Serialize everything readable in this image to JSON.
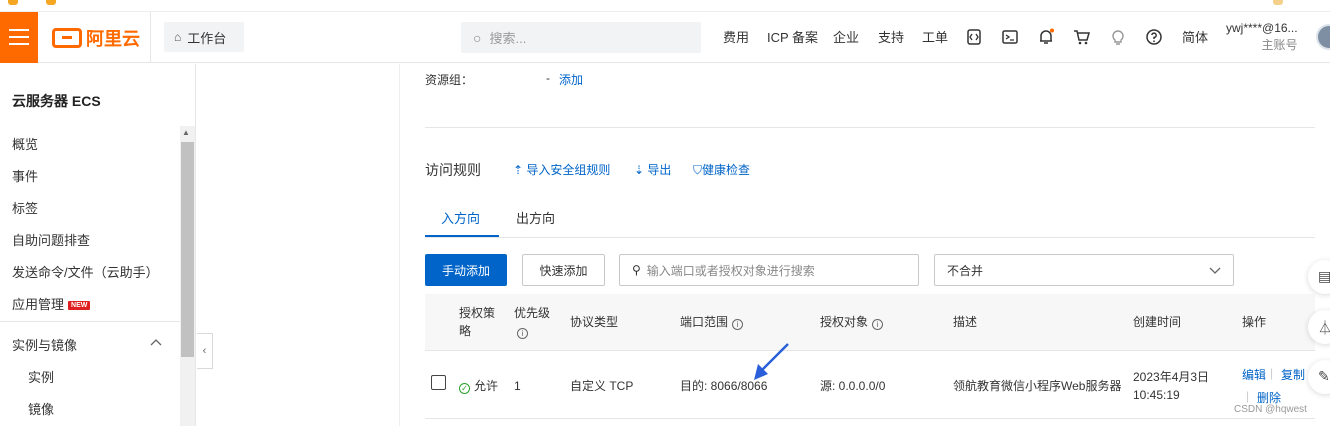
{
  "colors": {
    "brand": "#ff6a00",
    "link": "#0064c8",
    "success": "#2ba02b",
    "new_badge": "#e02020"
  },
  "topbar": {
    "logo_text": "阿里云",
    "workbench_label": "工作台",
    "search_placeholder": "搜索...",
    "nav": [
      "费用",
      "ICP 备案",
      "企业",
      "支持",
      "工单"
    ],
    "icons": [
      "api-icon",
      "terminal-icon",
      "bell-icon",
      "cart-icon",
      "lightbulb-icon",
      "help-icon"
    ],
    "lang": "简体",
    "user_name": "ywj****@16...",
    "user_role": "主账号"
  },
  "sidebar": {
    "title": "云服务器 ECS",
    "items": [
      "概览",
      "事件",
      "标签",
      "自助问题排查",
      "发送命令/文件（云助手）",
      "应用管理"
    ],
    "new_badge": "NEW",
    "group": "实例与镜像",
    "subitems": [
      "实例",
      "镜像"
    ]
  },
  "content": {
    "resource_group_label": "资源组：",
    "resource_group_value": "-",
    "resource_group_add": "添加",
    "rules_title": "访问规则",
    "links": [
      "导入安全组规则",
      "导出",
      "健康检查"
    ],
    "tabs": [
      "入方向",
      "出方向"
    ],
    "btn_manual": "手动添加",
    "btn_quick": "快速添加",
    "filter_placeholder": "输入端口或者授权对象进行搜索",
    "merge_select": "不合并"
  },
  "table": {
    "headers": {
      "policy_1": "授权策",
      "policy_2": "略",
      "priority": "优先级",
      "protocol": "协议类型",
      "port": "端口范围",
      "target": "授权对象",
      "desc": "描述",
      "created": "创建时间",
      "ops": "操作"
    },
    "rows": [
      {
        "policy": "允许",
        "priority": "1",
        "protocol": "自定义 TCP",
        "port": "目的: 8066/8066",
        "target": "源: 0.0.0.0/0",
        "desc": "领航教育微信小程序Web服务器",
        "created_date": "2023年4月3日",
        "created_time": "10:45:19",
        "ops": [
          "编辑",
          "复制",
          "删除"
        ]
      }
    ]
  },
  "watermark": "CSDN @hqwest"
}
